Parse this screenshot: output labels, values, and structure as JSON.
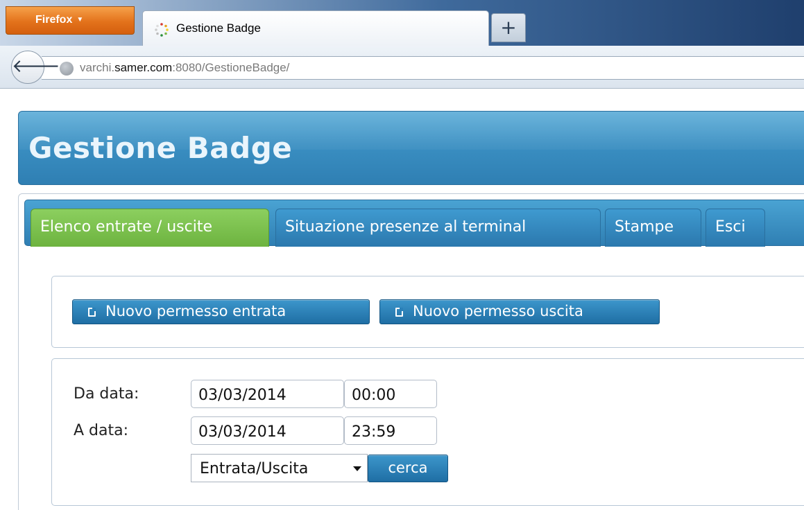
{
  "browser": {
    "menu_button": "Firefox",
    "tab_title": "Gestione Badge",
    "new_tab": "+",
    "url_prefix": "varchi.",
    "url_host": "samer.com",
    "url_suffix": ":8080/GestioneBadge/"
  },
  "app": {
    "title": "Gestione Badge"
  },
  "tabs": [
    {
      "label": "Elenco entrate / uscite",
      "active": true
    },
    {
      "label": "Situazione presenze al terminal",
      "active": false
    },
    {
      "label": "Stampe",
      "active": false
    },
    {
      "label": "Esci",
      "active": false
    }
  ],
  "actions": {
    "new_entry": "Nuovo permesso entrata",
    "new_exit": "Nuovo permesso uscita"
  },
  "search": {
    "from_label": "Da data:",
    "from_date": "03/03/2014",
    "from_time": "00:00",
    "to_label": "A data:",
    "to_date": "03/03/2014",
    "to_time": "23:59",
    "type_selected": "Entrata/Uscita",
    "search_button": "cerca"
  },
  "icons": {
    "back": "arrow-left-icon",
    "site": "globe-icon",
    "document": "document-icon"
  },
  "colors": {
    "accent_blue": "#2f7fb3",
    "active_tab_green": "#6db33f",
    "firefox_orange": "#e3721b"
  }
}
